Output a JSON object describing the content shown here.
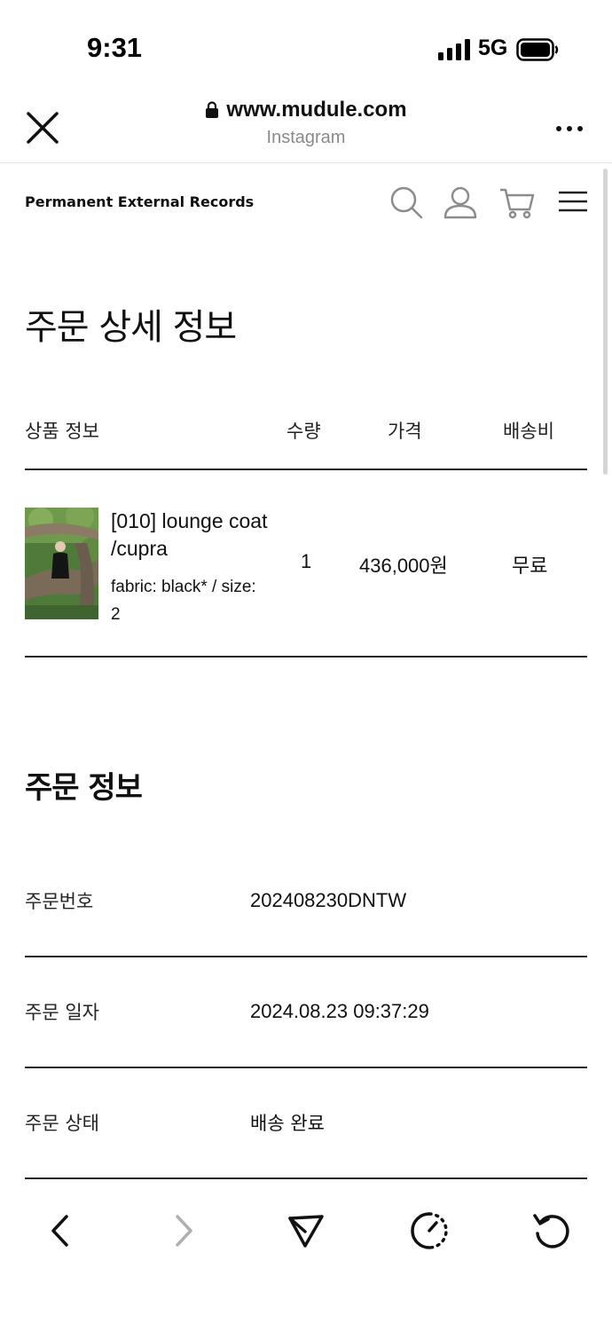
{
  "status_bar": {
    "time": "9:31",
    "network": "5G",
    "signal_icon": "signal-bars-icon",
    "battery_icon": "battery-icon"
  },
  "browser": {
    "url": "www.mudule.com",
    "source": "Instagram",
    "close_icon": "close-icon",
    "more_icon": "more-dots-icon"
  },
  "site_header": {
    "brand": "Permanent External Records",
    "icons": [
      "search-icon",
      "user-icon",
      "cart-icon",
      "menu-icon"
    ]
  },
  "page_title": "주문 상세 정보",
  "product_table": {
    "headers": {
      "product": "상품 정보",
      "quantity": "수량",
      "price": "가격",
      "shipping": "배송비"
    },
    "rows": [
      {
        "name": "[010] lounge coat /cupra",
        "options": "fabric: black* / size: 2",
        "quantity": "1",
        "price": "436,000원",
        "shipping": "무료"
      }
    ]
  },
  "order_info": {
    "title": "주문 정보",
    "rows": [
      {
        "label": "주문번호",
        "value": "202408230DNTW"
      },
      {
        "label": "주문 일자",
        "value": "2024.08.23 09:37:29"
      },
      {
        "label": "주문 상태",
        "value": "배송 완료"
      }
    ]
  },
  "toolbar": {
    "icons": [
      "back-icon",
      "forward-icon",
      "share-icon",
      "speed-icon",
      "reload-icon"
    ]
  },
  "colors": {
    "text": "#111111",
    "muted": "#8a8a8a",
    "rule": "#222222",
    "disabled": "#b0b0b0"
  }
}
